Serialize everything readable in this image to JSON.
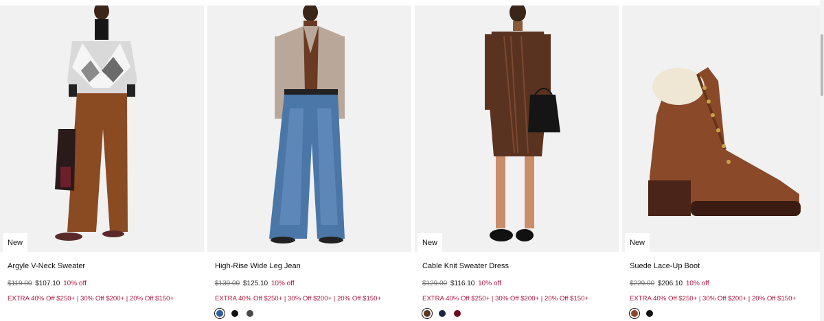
{
  "products": [
    {
      "name": "Argyle V-Neck Sweater",
      "badge": "New",
      "original_price": "$119.00",
      "sale_price": "$107.10",
      "discount": "10% off",
      "promo": "EXTRA 40% Off $250+ | 30% Off $200+ | 20% Off $150+",
      "swatches": []
    },
    {
      "name": "High-Rise Wide Leg Jean",
      "badge": "",
      "original_price": "$139.00",
      "sale_price": "$125.10",
      "discount": "10% off",
      "promo": "EXTRA 40% Off $250+ | 30% Off $200+ | 20% Off $150+",
      "swatches": [
        {
          "color": "#2f5f9e",
          "selected": true
        },
        {
          "color": "#111111",
          "selected": false
        },
        {
          "color": "#4a4a4a",
          "selected": false
        }
      ]
    },
    {
      "name": "Cable Knit Sweater Dress",
      "badge": "New",
      "original_price": "$129.00",
      "sale_price": "$116.10",
      "discount": "10% off",
      "promo": "EXTRA 40% Off $250+ | 30% Off $200+ | 20% Off $150+",
      "swatches": [
        {
          "color": "#5a3624",
          "selected": true
        },
        {
          "color": "#1a2540",
          "selected": false
        },
        {
          "color": "#6b1020",
          "selected": false
        }
      ]
    },
    {
      "name": "Suede Lace-Up Boot",
      "badge": "New",
      "original_price": "$229.00",
      "sale_price": "$206.10",
      "discount": "10% off",
      "promo": "EXTRA 40% Off $250+ | 30% Off $200+ | 20% Off $150+",
      "swatches": [
        {
          "color": "#8a4a2a",
          "selected": true
        },
        {
          "color": "#111111",
          "selected": false
        }
      ]
    }
  ],
  "colors": {
    "discount_red": "#b0143c",
    "image_bg": "#f1f1f1"
  }
}
